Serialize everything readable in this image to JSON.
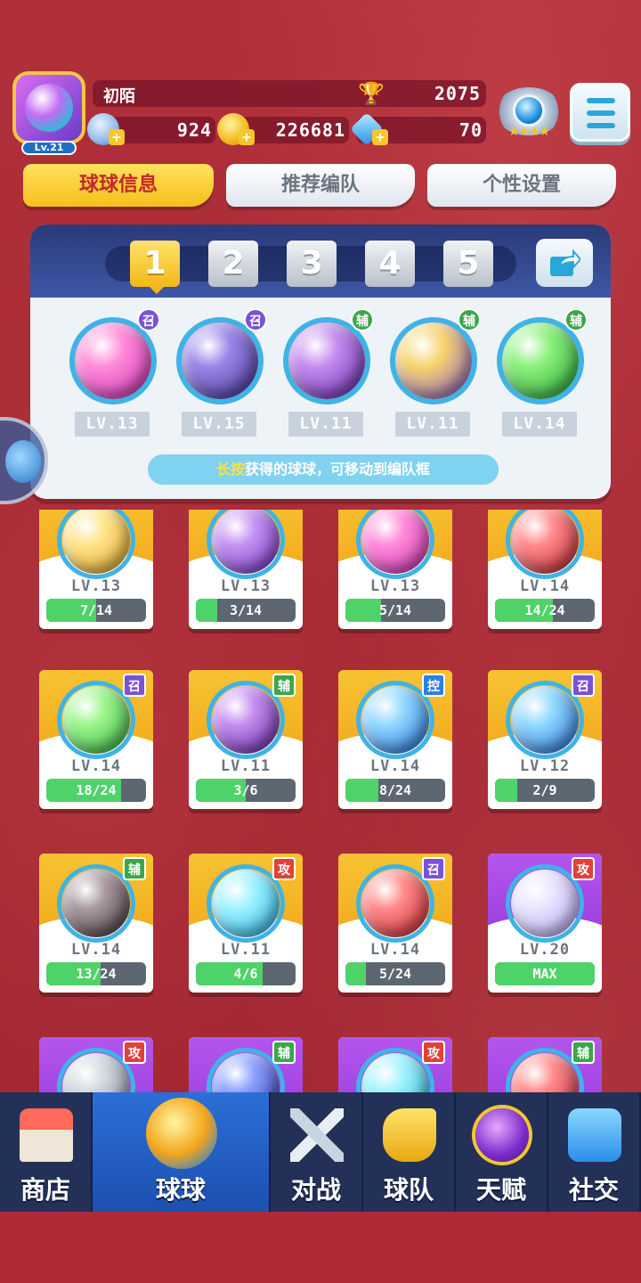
{
  "player": {
    "name": "初陌",
    "avatar_level": "Lv.21",
    "trophies": "2075",
    "currency_energy": "924",
    "currency_gold": "226681",
    "currency_diamond": "70"
  },
  "tabs": [
    "球球信息",
    "推荐编队",
    "个性设置"
  ],
  "lineup": {
    "slots": [
      "1",
      "2",
      "3",
      "4",
      "5"
    ],
    "selected_slot": "1",
    "balls": [
      {
        "level": "LV.13",
        "badge": "召",
        "badge_color": "#7a52d8",
        "orb": "pink-sword",
        "colors": [
          "#ff8ad9",
          "#c02aa8"
        ]
      },
      {
        "level": "LV.15",
        "badge": "召",
        "badge_color": "#7a52d8",
        "orb": "ghost",
        "colors": [
          "#9a86e8",
          "#3a2a86"
        ]
      },
      {
        "level": "LV.11",
        "badge": "辅",
        "badge_color": "#3aa84a",
        "orb": "leaf",
        "colors": [
          "#c58cf0",
          "#5b1f9c"
        ]
      },
      {
        "level": "LV.11",
        "badge": "辅",
        "badge_color": "#3aa84a",
        "orb": "people",
        "colors": [
          "#f7d36c",
          "#7a4fd0"
        ]
      },
      {
        "level": "LV.14",
        "badge": "辅",
        "badge_color": "#3aa84a",
        "orb": "arrow-up",
        "colors": [
          "#8af07a",
          "#1f9a34"
        ]
      }
    ],
    "hint_highlight": "长按",
    "hint_text": "获得的球球，可移动到编队框"
  },
  "collection": {
    "rows": [
      [
        {
          "level": "LV.13",
          "progress": "7/14",
          "fill": 0.5,
          "color": [
            "#ffe48a",
            "#d69a1c"
          ],
          "card": "gold",
          "icon": "shuriken"
        },
        {
          "level": "LV.13",
          "progress": "3/14",
          "fill": 0.214,
          "color": [
            "#c593f2",
            "#6a2ab8"
          ],
          "card": "gold",
          "icon": "orbit"
        },
        {
          "level": "LV.13",
          "progress": "5/14",
          "fill": 0.357,
          "color": [
            "#ff8ad9",
            "#c02aa8"
          ],
          "card": "gold",
          "icon": "sword"
        },
        {
          "level": "LV.14",
          "progress": "14/24",
          "fill": 0.583,
          "color": [
            "#ff8a8a",
            "#b21f2a"
          ],
          "card": "gold",
          "icon": "fist"
        }
      ],
      [
        {
          "level": "LV.14",
          "progress": "18/24",
          "fill": 0.75,
          "badge": "召",
          "badge_color": "#7a52d8",
          "color": [
            "#9cf58a",
            "#2aa83a"
          ],
          "card": "gold",
          "icon": "star"
        },
        {
          "level": "LV.11",
          "progress": "3/6",
          "fill": 0.5,
          "badge": "辅",
          "badge_color": "#3aa84a",
          "color": [
            "#c58cf0",
            "#5b1f9c"
          ],
          "card": "gold",
          "icon": "leaf"
        },
        {
          "level": "LV.14",
          "progress": "8/24",
          "fill": 0.333,
          "badge": "控",
          "badge_color": "#2f7fe0",
          "color": [
            "#8fd8ff",
            "#1f64d0"
          ],
          "card": "gold",
          "icon": "snowflake"
        },
        {
          "level": "LV.12",
          "progress": "2/9",
          "fill": 0.222,
          "badge": "召",
          "badge_color": "#7a52d8",
          "color": [
            "#8fd8ff",
            "#1f64d0"
          ],
          "card": "gold",
          "icon": "ice"
        }
      ],
      [
        {
          "level": "LV.14",
          "progress": "13/24",
          "fill": 0.542,
          "badge": "辅",
          "badge_color": "#3aa84a",
          "color": [
            "#a89aa0",
            "#3a2a30"
          ],
          "card": "gold",
          "icon": "skull"
        },
        {
          "level": "LV.11",
          "progress": "4/6",
          "fill": 0.667,
          "badge": "攻",
          "badge_color": "#e0423a",
          "color": [
            "#9ff2ff",
            "#1aa8d8"
          ],
          "card": "gold",
          "icon": "sword-cyan"
        },
        {
          "level": "LV.14",
          "progress": "5/24",
          "fill": 0.208,
          "badge": "召",
          "badge_color": "#7a52d8",
          "color": [
            "#ff8a8a",
            "#c0202a"
          ],
          "card": "gold",
          "icon": "cannon"
        },
        {
          "level": "LV.20",
          "progress": "MAX",
          "fill": 1.0,
          "badge": "攻",
          "badge_color": "#e0423a",
          "color": [
            "#e8e4ff",
            "#a89ae8"
          ],
          "card": "purple",
          "icon": "bubble"
        }
      ],
      [
        {
          "badge": "攻",
          "badge_color": "#e0423a",
          "color": [
            "#d0d8e0",
            "#6a7a8a"
          ],
          "card": "purple",
          "icon": "swirl"
        },
        {
          "badge": "辅",
          "badge_color": "#3aa84a",
          "color": [
            "#8aa0ff",
            "#2a2aa8"
          ],
          "card": "purple",
          "icon": "wave"
        },
        {
          "badge": "攻",
          "badge_color": "#e0423a",
          "color": [
            "#9ff2ff",
            "#1aa8c8"
          ],
          "card": "purple",
          "icon": "water"
        },
        {
          "badge": "辅",
          "badge_color": "#3aa84a",
          "color": [
            "#ff8a8a",
            "#b21f3a"
          ],
          "card": "purple",
          "icon": "fang"
        }
      ]
    ]
  },
  "nav": [
    {
      "label": "商店",
      "icon": "shop-icon"
    },
    {
      "label": "球球",
      "icon": "ball-icon",
      "active": true
    },
    {
      "label": "对战",
      "icon": "swords-icon"
    },
    {
      "label": "球队",
      "icon": "whistle-icon"
    },
    {
      "label": "天赋",
      "icon": "planet-icon"
    },
    {
      "label": "社交",
      "icon": "chat-icon"
    }
  ]
}
